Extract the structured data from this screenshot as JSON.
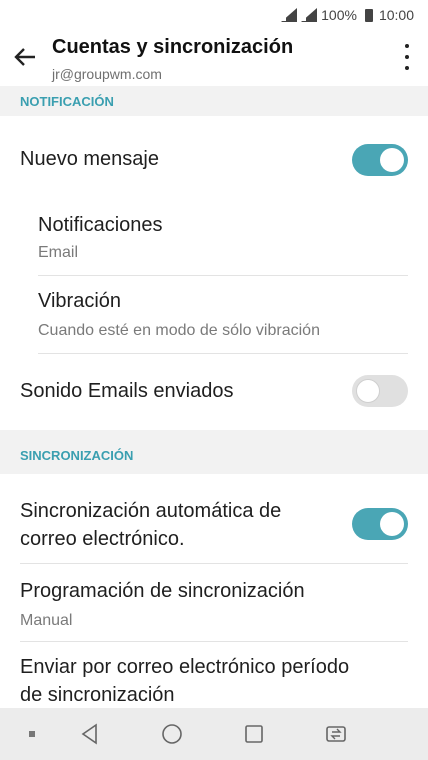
{
  "status": {
    "battery": "100%",
    "time": "10:00",
    "icons": [
      "signal-icon",
      "signal-icon",
      "battery-icon"
    ]
  },
  "appbar": {
    "title": "Cuentas y sincronización",
    "subtitle": "jr@groupwm.com",
    "back_icon": "arrow-left-icon",
    "menu_icon": "more-vertical-icon"
  },
  "sections": {
    "notificacion": "NOTIFICACIÓN",
    "sincronizacion": "SINCRONIZACIÓN"
  },
  "items": {
    "nuevo_mensaje": {
      "label": "Nuevo mensaje",
      "toggle": true
    },
    "notificaciones": {
      "label": "Notificaciones",
      "sub": "Email"
    },
    "vibracion": {
      "label": "Vibración",
      "sub": "Cuando esté en modo de sólo vibración"
    },
    "sonido": {
      "label": "Sonido Emails enviados",
      "toggle": false
    },
    "sync_auto": {
      "label_line1": "Sincronización automática de",
      "label_line2": "correo electrónico.",
      "toggle": true
    },
    "programacion": {
      "label": "Programación de sincronización",
      "sub": "Manual"
    },
    "periodo": {
      "label_line1": "Enviar por correo electrónico período",
      "label_line2": "de sincronización"
    }
  },
  "colors": {
    "accent": "#4aa6b5",
    "section_text": "#3a9fb0",
    "section_bg": "#f2f2f2",
    "toggle_off": "#e0e0e0"
  },
  "navbar": {
    "icons": [
      "dot-icon",
      "back-triangle-icon",
      "home-circle-icon",
      "recents-square-icon",
      "dual-window-icon"
    ]
  }
}
